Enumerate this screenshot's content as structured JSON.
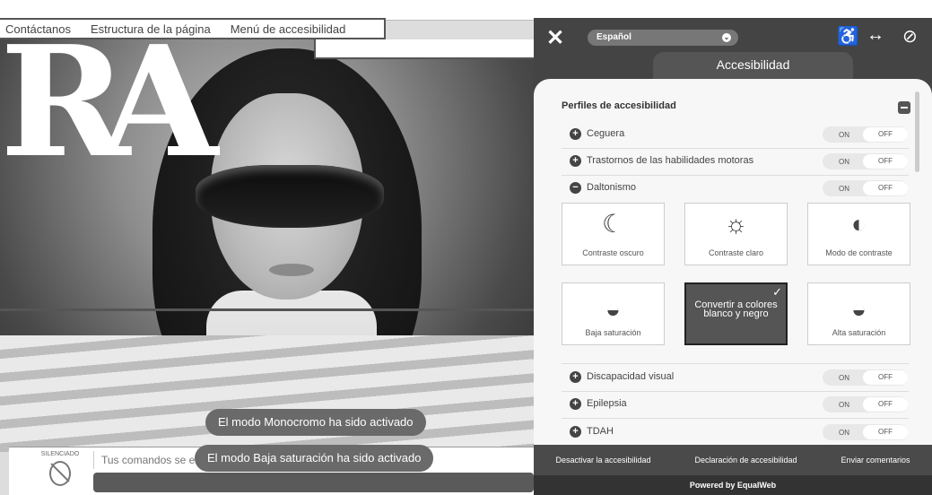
{
  "site": {
    "menu": [
      "Contáctanos",
      "Estructura de la página",
      "Menú de accesibilidad"
    ],
    "logo_text": "RA",
    "voice": {
      "muted_label": "SILENCIADO",
      "input_placeholder": "Tus comandos se enl"
    }
  },
  "toasts": [
    "El modo Monocromo ha sido activado",
    "El modo Baja saturación ha sido activado"
  ],
  "panel": {
    "language": "Español",
    "title": "Accesibilidad",
    "profiles_title": "Perfiles de accesibilidad",
    "toggle_on": "ON",
    "toggle_off": "OFF",
    "profiles": [
      {
        "label": "Ceguera",
        "expanded": false
      },
      {
        "label": "Trastornos de las habilidades motoras",
        "expanded": false
      },
      {
        "label": "Daltonismo",
        "expanded": true
      },
      {
        "label": "Discapacidad visual",
        "expanded": false
      },
      {
        "label": "Epilepsia",
        "expanded": false
      },
      {
        "label": "TDAH",
        "expanded": false
      }
    ],
    "options": [
      {
        "label": "Contraste oscuro",
        "icon": "moon-icon",
        "selected": false
      },
      {
        "label": "Contraste claro",
        "icon": "sun-icon",
        "selected": false
      },
      {
        "label": "Modo de contraste",
        "icon": "contrast-icon",
        "selected": false
      },
      {
        "label": "Baja saturación",
        "icon": "drop-low-icon",
        "selected": false
      },
      {
        "label": "Convertir a colores blanco y negro",
        "icon": "check-icon",
        "selected": true
      },
      {
        "label": "Alta saturación",
        "icon": "drop-high-icon",
        "selected": false
      }
    ],
    "footer": {
      "links": [
        "Desactivar la accesibilidad",
        "Declaración de accesibilidad",
        "Enviar comentarios"
      ],
      "powered_by": "Powered by EqualWeb"
    }
  }
}
